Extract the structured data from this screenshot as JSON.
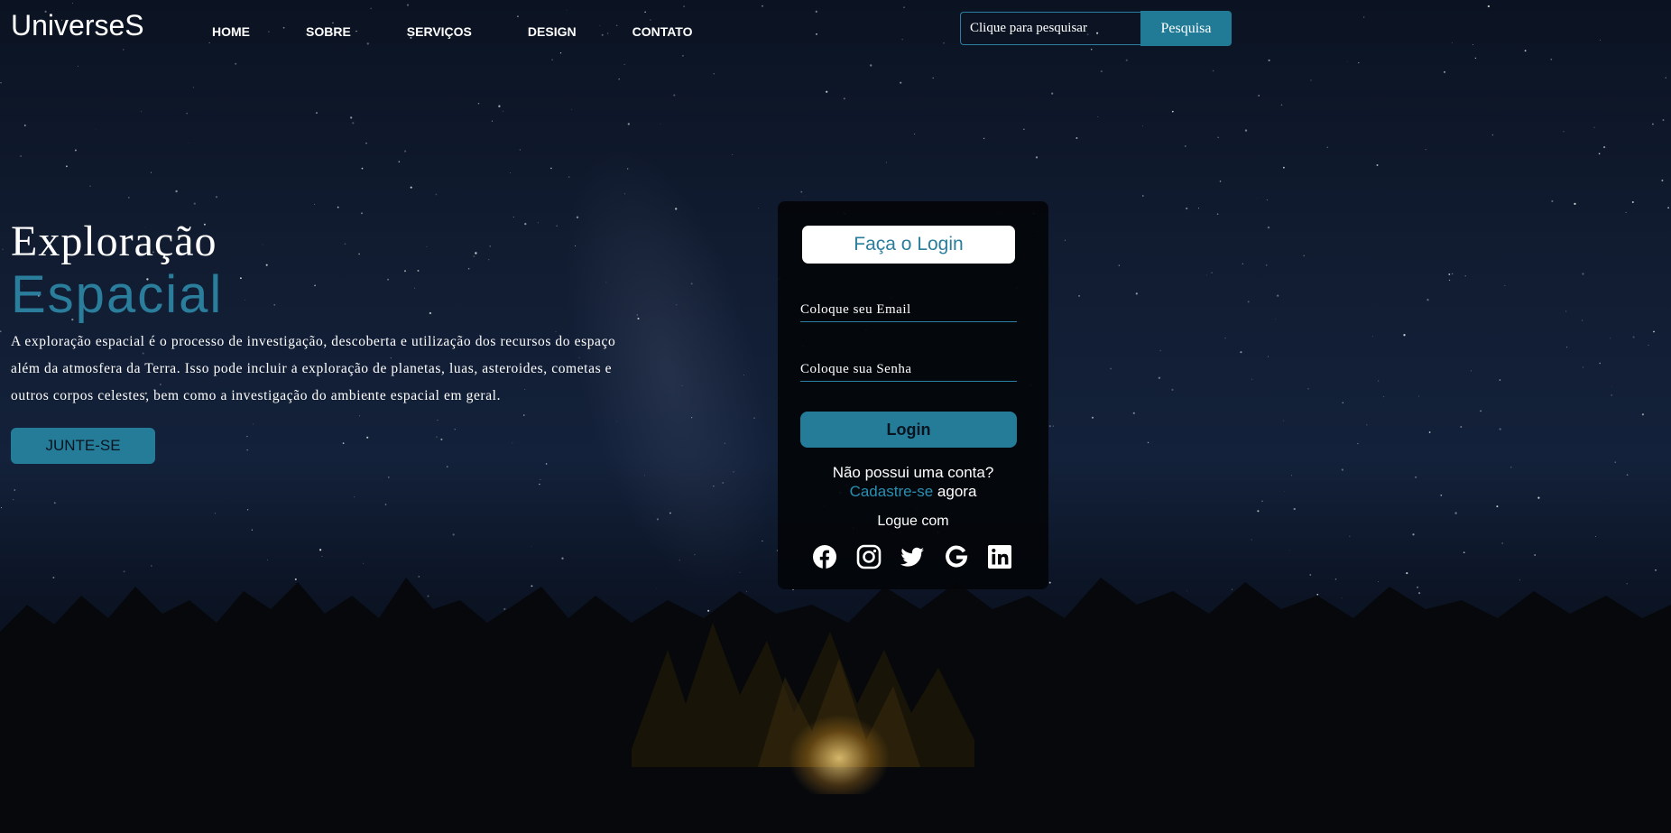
{
  "header": {
    "logo": "UniverseS",
    "nav": [
      "HOME",
      "SOBRE",
      "SERVIÇOS",
      "DESIGN",
      "CONTATO"
    ],
    "search_placeholder": "Clique para pesquisar",
    "search_button": "Pesquisa"
  },
  "hero": {
    "title_line1": "Exploração",
    "title_line2": "Espacial",
    "description": "A exploração espacial é o processo de investigação, descoberta e utilização dos recursos do espaço além da atmosfera da Terra. Isso pode incluir a exploração de planetas, luas, asteroides, cometas e outros corpos celestes, bem como a investigação do ambiente espacial em geral.",
    "join_button": "JUNTE-SE"
  },
  "login": {
    "title": "Faça o Login",
    "email_placeholder": "Coloque seu Email",
    "password_placeholder": "Coloque sua Senha",
    "submit": "Login",
    "no_account": "Não possui uma conta?",
    "signup_link": "Cadastre-se",
    "signup_suffix": "agora",
    "login_with": "Logue com",
    "social_icons": [
      "facebook-icon",
      "instagram-icon",
      "twitter-icon",
      "google-icon",
      "linkedin-icon"
    ]
  },
  "colors": {
    "accent": "#247c98",
    "title_accent": "#2a7e9c",
    "link": "#2a8fb2",
    "card_bg": "#030509"
  }
}
